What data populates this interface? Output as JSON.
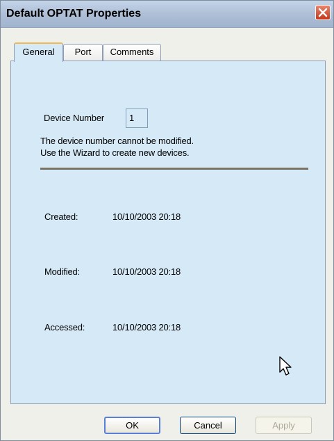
{
  "window": {
    "title": "Default OPTAT Properties"
  },
  "tabs": [
    {
      "label": "General",
      "active": true
    },
    {
      "label": "Port",
      "active": false
    },
    {
      "label": "Comments",
      "active": false
    }
  ],
  "general": {
    "device_number_label": "Device Number",
    "device_number_value": "1",
    "note_line1": "The device number cannot be modified.",
    "note_line2": "Use the Wizard to create new devices.",
    "created_label": "Created:",
    "created_value": "10/10/2003 20:18",
    "modified_label": "Modified:",
    "modified_value": "10/10/2003 20:18",
    "accessed_label": "Accessed:",
    "accessed_value": "10/10/2003 20:18"
  },
  "buttons": {
    "ok": "OK",
    "cancel": "Cancel",
    "apply": "Apply"
  },
  "colors": {
    "panel_background": "#d6e9f7",
    "close_button": "#c2391a",
    "active_tab_highlight": "#f3b94e"
  },
  "icons": {
    "close": "close-x-icon",
    "cursor": "mouse-pointer-icon"
  }
}
